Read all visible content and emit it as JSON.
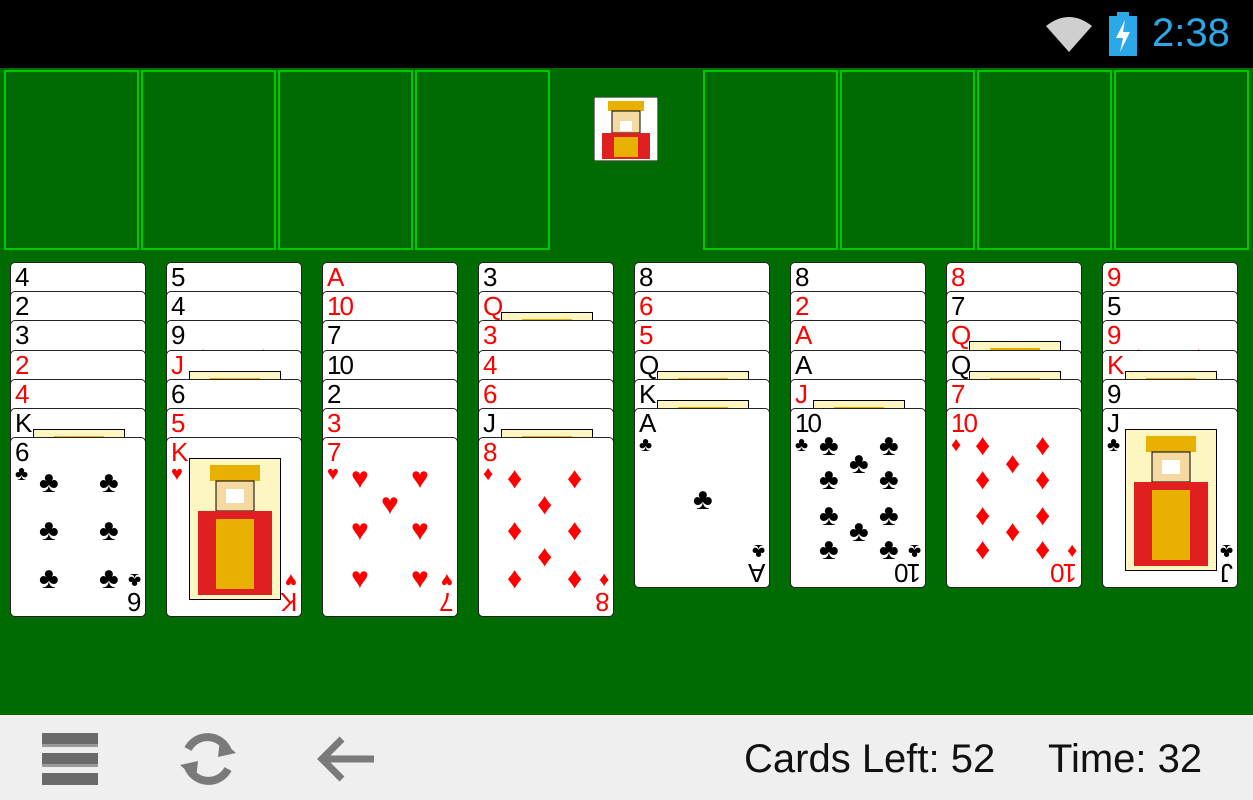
{
  "status_bar": {
    "time": "2:38",
    "icons": [
      "wifi-icon",
      "battery-charging-icon"
    ]
  },
  "bottom_bar": {
    "cards_left_label": "Cards Left:",
    "cards_left_value": "52",
    "time_label": "Time:",
    "time_value": "32",
    "buttons": [
      "menu-icon",
      "restart-icon",
      "undo-arrow-icon"
    ]
  },
  "colors": {
    "felt": "#006b00",
    "cell_border": "#00c800",
    "clock": "#2aa8e8",
    "red_suit": "#ff0000"
  },
  "columns": [
    [
      {
        "r": "4",
        "s": "♠"
      },
      {
        "r": "2",
        "s": "♠"
      },
      {
        "r": "3",
        "s": "♠"
      },
      {
        "r": "2",
        "s": "♥"
      },
      {
        "r": "4",
        "s": "♥"
      },
      {
        "r": "K",
        "s": "♣"
      },
      {
        "r": "6",
        "s": "♣"
      }
    ],
    [
      {
        "r": "5",
        "s": "♠"
      },
      {
        "r": "4",
        "s": "♠"
      },
      {
        "r": "9",
        "s": "♠"
      },
      {
        "r": "J",
        "s": "♥"
      },
      {
        "r": "6",
        "s": "♠"
      },
      {
        "r": "5",
        "s": "♥"
      },
      {
        "r": "K",
        "s": "♥"
      }
    ],
    [
      {
        "r": "A",
        "s": "♥"
      },
      {
        "r": "10",
        "s": "♥"
      },
      {
        "r": "7",
        "s": "♠"
      },
      {
        "r": "10",
        "s": "♠"
      },
      {
        "r": "2",
        "s": "♠"
      },
      {
        "r": "3",
        "s": "♥"
      },
      {
        "r": "7",
        "s": "♥"
      }
    ],
    [
      {
        "r": "3",
        "s": "♠"
      },
      {
        "r": "Q",
        "s": "♥"
      },
      {
        "r": "3",
        "s": "♥"
      },
      {
        "r": "4",
        "s": "♦"
      },
      {
        "r": "6",
        "s": "♦"
      },
      {
        "r": "J",
        "s": "♣"
      },
      {
        "r": "8",
        "s": "♦"
      }
    ],
    [
      {
        "r": "8",
        "s": "♠"
      },
      {
        "r": "6",
        "s": "♥"
      },
      {
        "r": "5",
        "s": "♥"
      },
      {
        "r": "Q",
        "s": "♣"
      },
      {
        "r": "K",
        "s": "♠"
      },
      {
        "r": "A",
        "s": "♣"
      }
    ],
    [
      {
        "r": "8",
        "s": "♠"
      },
      {
        "r": "2",
        "s": "♦"
      },
      {
        "r": "A",
        "s": "♦"
      },
      {
        "r": "A",
        "s": "♠"
      },
      {
        "r": "J",
        "s": "♦"
      },
      {
        "r": "10",
        "s": "♣"
      }
    ],
    [
      {
        "r": "8",
        "s": "♥"
      },
      {
        "r": "7",
        "s": "♠"
      },
      {
        "r": "Q",
        "s": "♦"
      },
      {
        "r": "Q",
        "s": "♠"
      },
      {
        "r": "7",
        "s": "♦"
      },
      {
        "r": "10",
        "s": "♦"
      }
    ],
    [
      {
        "r": "9",
        "s": "♥"
      },
      {
        "r": "5",
        "s": "♠"
      },
      {
        "r": "9",
        "s": "♦"
      },
      {
        "r": "K",
        "s": "♦"
      },
      {
        "r": "9",
        "s": "♠"
      },
      {
        "r": "J",
        "s": "♣"
      }
    ]
  ]
}
